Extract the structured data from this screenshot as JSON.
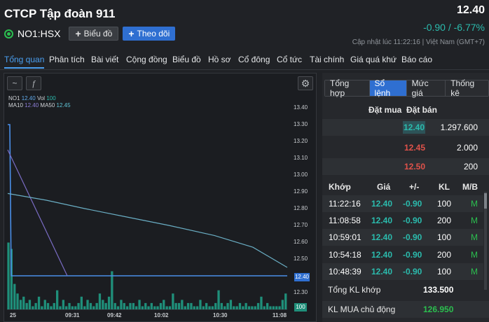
{
  "header": {
    "title": "CTCP Tập đoàn 911",
    "ticker": "NO1:HSX",
    "chart_button": "Biểu đồ",
    "follow_button": "Theo dõi",
    "price": "12.40",
    "change": "-0.90 / -6.77%",
    "updated": "Cập nhật lúc  11:22:16 | Việt Nam (GMT+7)",
    "colors": {
      "up": "#2bbbad",
      "down": "#e0524a",
      "accent": "#2f6fd1"
    }
  },
  "tabs": [
    "Tổng quan",
    "Phân tích",
    "Bài viết",
    "Cộng đồng",
    "Biểu đồ",
    "Hồ sơ",
    "Cổ đông",
    "Cổ tức",
    "Tài chính",
    "Giá quá khứ",
    "Báo cáo"
  ],
  "chart": {
    "tools": {
      "line": "~",
      "fx": "f",
      "gear": "⚙"
    },
    "legend": {
      "line1": {
        "sym": "NO1",
        "v1": "12.40",
        "vol_label": "Vol",
        "vol": "100"
      },
      "line2": {
        "ma10": "MA10",
        "ma10v": "12.40",
        "ma50": "MA50",
        "ma50v": "12.45"
      }
    },
    "price_tag": "12.40",
    "vol_tag": "100"
  },
  "chart_data": {
    "type": "line",
    "y_ticks": [
      "13.40",
      "13.30",
      "13.20",
      "13.10",
      "13.00",
      "12.90",
      "12.80",
      "12.70",
      "12.60",
      "12.50",
      "12.40",
      "12.30"
    ],
    "x_ticks": [
      "25",
      "09:31",
      "09:42",
      "10:02",
      "10:30",
      "11:08"
    ],
    "ylim": [
      12.25,
      13.45
    ],
    "series": [
      {
        "name": "NO1",
        "color": "#4a8fe8",
        "values": [
          13.3,
          12.4,
          12.4,
          12.4,
          12.4,
          12.4,
          12.4
        ]
      },
      {
        "name": "MA10",
        "color": "#7a6cc4",
        "values": [
          13.15,
          12.4
        ]
      },
      {
        "name": "MA50",
        "color": "#6aaec4",
        "values": [
          12.89,
          12.85,
          12.8,
          12.75,
          12.7,
          12.64,
          12.57,
          12.45
        ]
      }
    ],
    "volume": [
      21,
      19,
      8,
      5,
      3,
      4,
      2,
      3,
      1,
      2,
      4,
      1,
      3,
      2,
      1,
      2,
      6,
      1,
      3,
      1,
      2,
      1,
      1,
      2,
      4,
      1,
      3,
      2,
      1,
      2,
      5,
      3,
      2,
      4,
      12,
      2,
      1,
      3,
      2,
      1,
      2,
      2,
      1,
      3,
      1,
      2,
      1,
      2,
      1,
      1,
      2,
      3,
      1,
      1,
      5,
      2,
      2,
      3,
      1,
      2,
      2,
      1,
      1,
      3,
      1,
      2,
      1,
      1,
      2,
      6,
      2,
      1,
      2,
      3,
      1,
      1,
      2,
      1,
      2,
      1,
      1,
      1,
      2,
      4,
      1,
      2,
      1,
      1,
      1,
      1,
      3,
      5
    ]
  },
  "side": {
    "tabs": [
      "Tổng hợp",
      "Sổ lệnh",
      "Mức giá",
      "Thống kê"
    ],
    "orderbook": {
      "head_buy": "Đặt mua",
      "head_sell": "Đặt bán",
      "rows": [
        {
          "bid": "12.40",
          "ask_vol": "1.297.600"
        },
        {
          "ask": "12.45",
          "ask_vol": "2.000"
        },
        {
          "ask": "12.50",
          "ask_vol": "200"
        }
      ]
    },
    "trades": {
      "headers": [
        "Khớp",
        "Giá",
        "+/-",
        "KL",
        "M/B"
      ],
      "rows": [
        {
          "time": "11:22:16",
          "price": "12.40",
          "chg": "-0.90",
          "kl": "100",
          "mb": "M"
        },
        {
          "time": "11:08:58",
          "price": "12.40",
          "chg": "-0.90",
          "kl": "200",
          "mb": "M"
        },
        {
          "time": "10:59:01",
          "price": "12.40",
          "chg": "-0.90",
          "kl": "100",
          "mb": "M"
        },
        {
          "time": "10:54:18",
          "price": "12.40",
          "chg": "-0.90",
          "kl": "200",
          "mb": "M"
        },
        {
          "time": "10:48:39",
          "price": "12.40",
          "chg": "-0.90",
          "kl": "100",
          "mb": "M"
        }
      ]
    },
    "summary": {
      "total_label": "Tổng KL khớp",
      "total_value": "133.500",
      "buy_label": "KL MUA chủ động",
      "buy_value": "126.950"
    }
  }
}
